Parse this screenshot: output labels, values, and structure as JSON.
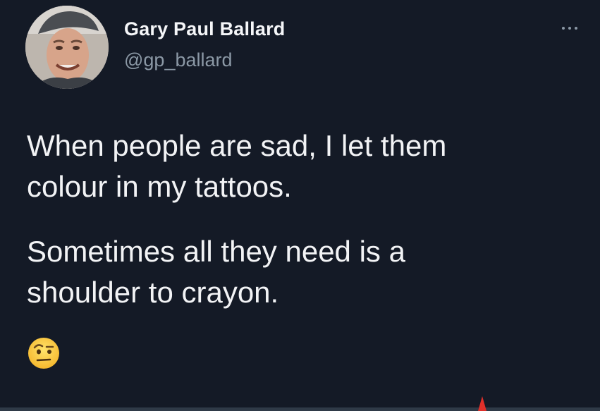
{
  "author": {
    "name": "Gary Paul Ballard",
    "handle": "@gp_ballard",
    "avatar_icon": "profile-photo"
  },
  "tweet": {
    "paragraphs": [
      "When people are sad, I let them\ncolour in my tattoos.",
      "Sometimes all they need is a\nshoulder to crayon."
    ],
    "emoji": "face-with-raised-eyebrow"
  },
  "menu": {
    "more_icon": "ellipsis-icon"
  },
  "colors": {
    "background": "#141a26",
    "text": "#f2f3f5",
    "secondary_text": "#8b98a5"
  }
}
